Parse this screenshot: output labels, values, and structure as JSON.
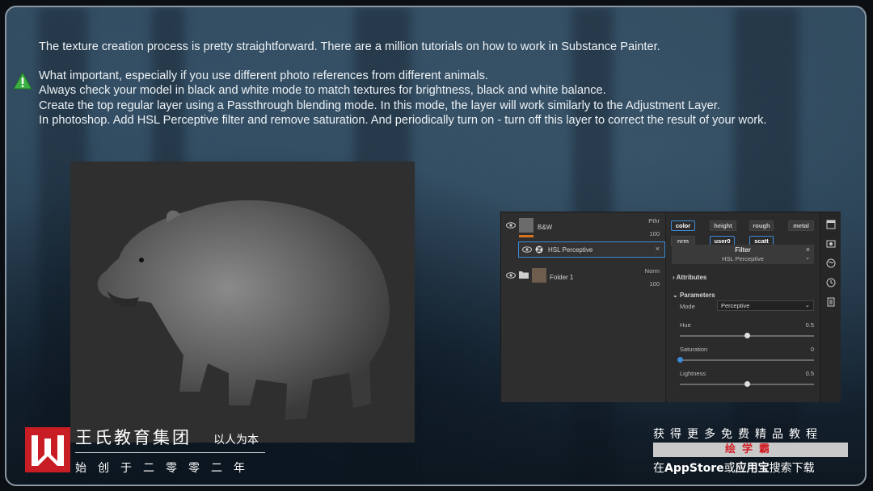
{
  "text": {
    "intro": "The texture creation process is pretty straightforward. There are a million tutorials on how to work in Substance Painter.",
    "lines": [
      "What important, especially if you use different photo references from different animals.",
      "Always check your model in black and white mode to match textures for brightness, black and white balance.",
      "Create the top regular layer using a Passthrough blending mode. In this mode, the layer will work similarly to the Adjustment Layer.",
      "In photoshop. Add HSL Perceptive filter and remove saturation. And periodically turn on - turn off this layer to correct the result of your work."
    ]
  },
  "layers": {
    "bw": {
      "name": "B&W",
      "blend": "Pthr",
      "opacity": "100"
    },
    "filter": {
      "name": "HSL Perceptive"
    },
    "folder": {
      "name": "Folder 1",
      "blend": "Norm",
      "opacity": "100"
    }
  },
  "channels": [
    "color",
    "height",
    "rough",
    "metal",
    "nrm",
    "user0",
    "scatt"
  ],
  "filter_panel": {
    "title": "Filter",
    "subtitle": "HSL Perceptive",
    "attributes": "Attributes",
    "parameters": "Parameters",
    "mode_label": "Mode",
    "mode_value": "Perceptive",
    "params": [
      {
        "label": "Hue",
        "value": "0.5",
        "level": 0.5
      },
      {
        "label": "Saturation",
        "value": "0",
        "level": 0.0
      },
      {
        "label": "Lightness",
        "value": "0.5",
        "level": 0.5
      }
    ]
  },
  "branding": {
    "name": "王氏教育集团",
    "motto": "以人为本",
    "since": "始创于二零零二年"
  },
  "promo": {
    "line1": "获得更多免费精品教程",
    "bar": "绘学霸",
    "line2_pre": "在",
    "line2_app1": "AppStore",
    "line2_mid": "或",
    "line2_app2": "应用宝",
    "line2_post": "搜索下载"
  },
  "colors": {
    "accent_blue": "#3c8ad8",
    "accent_orange": "#d6731e",
    "brand_red": "#c81d24",
    "warning_green": "#3cb043"
  }
}
